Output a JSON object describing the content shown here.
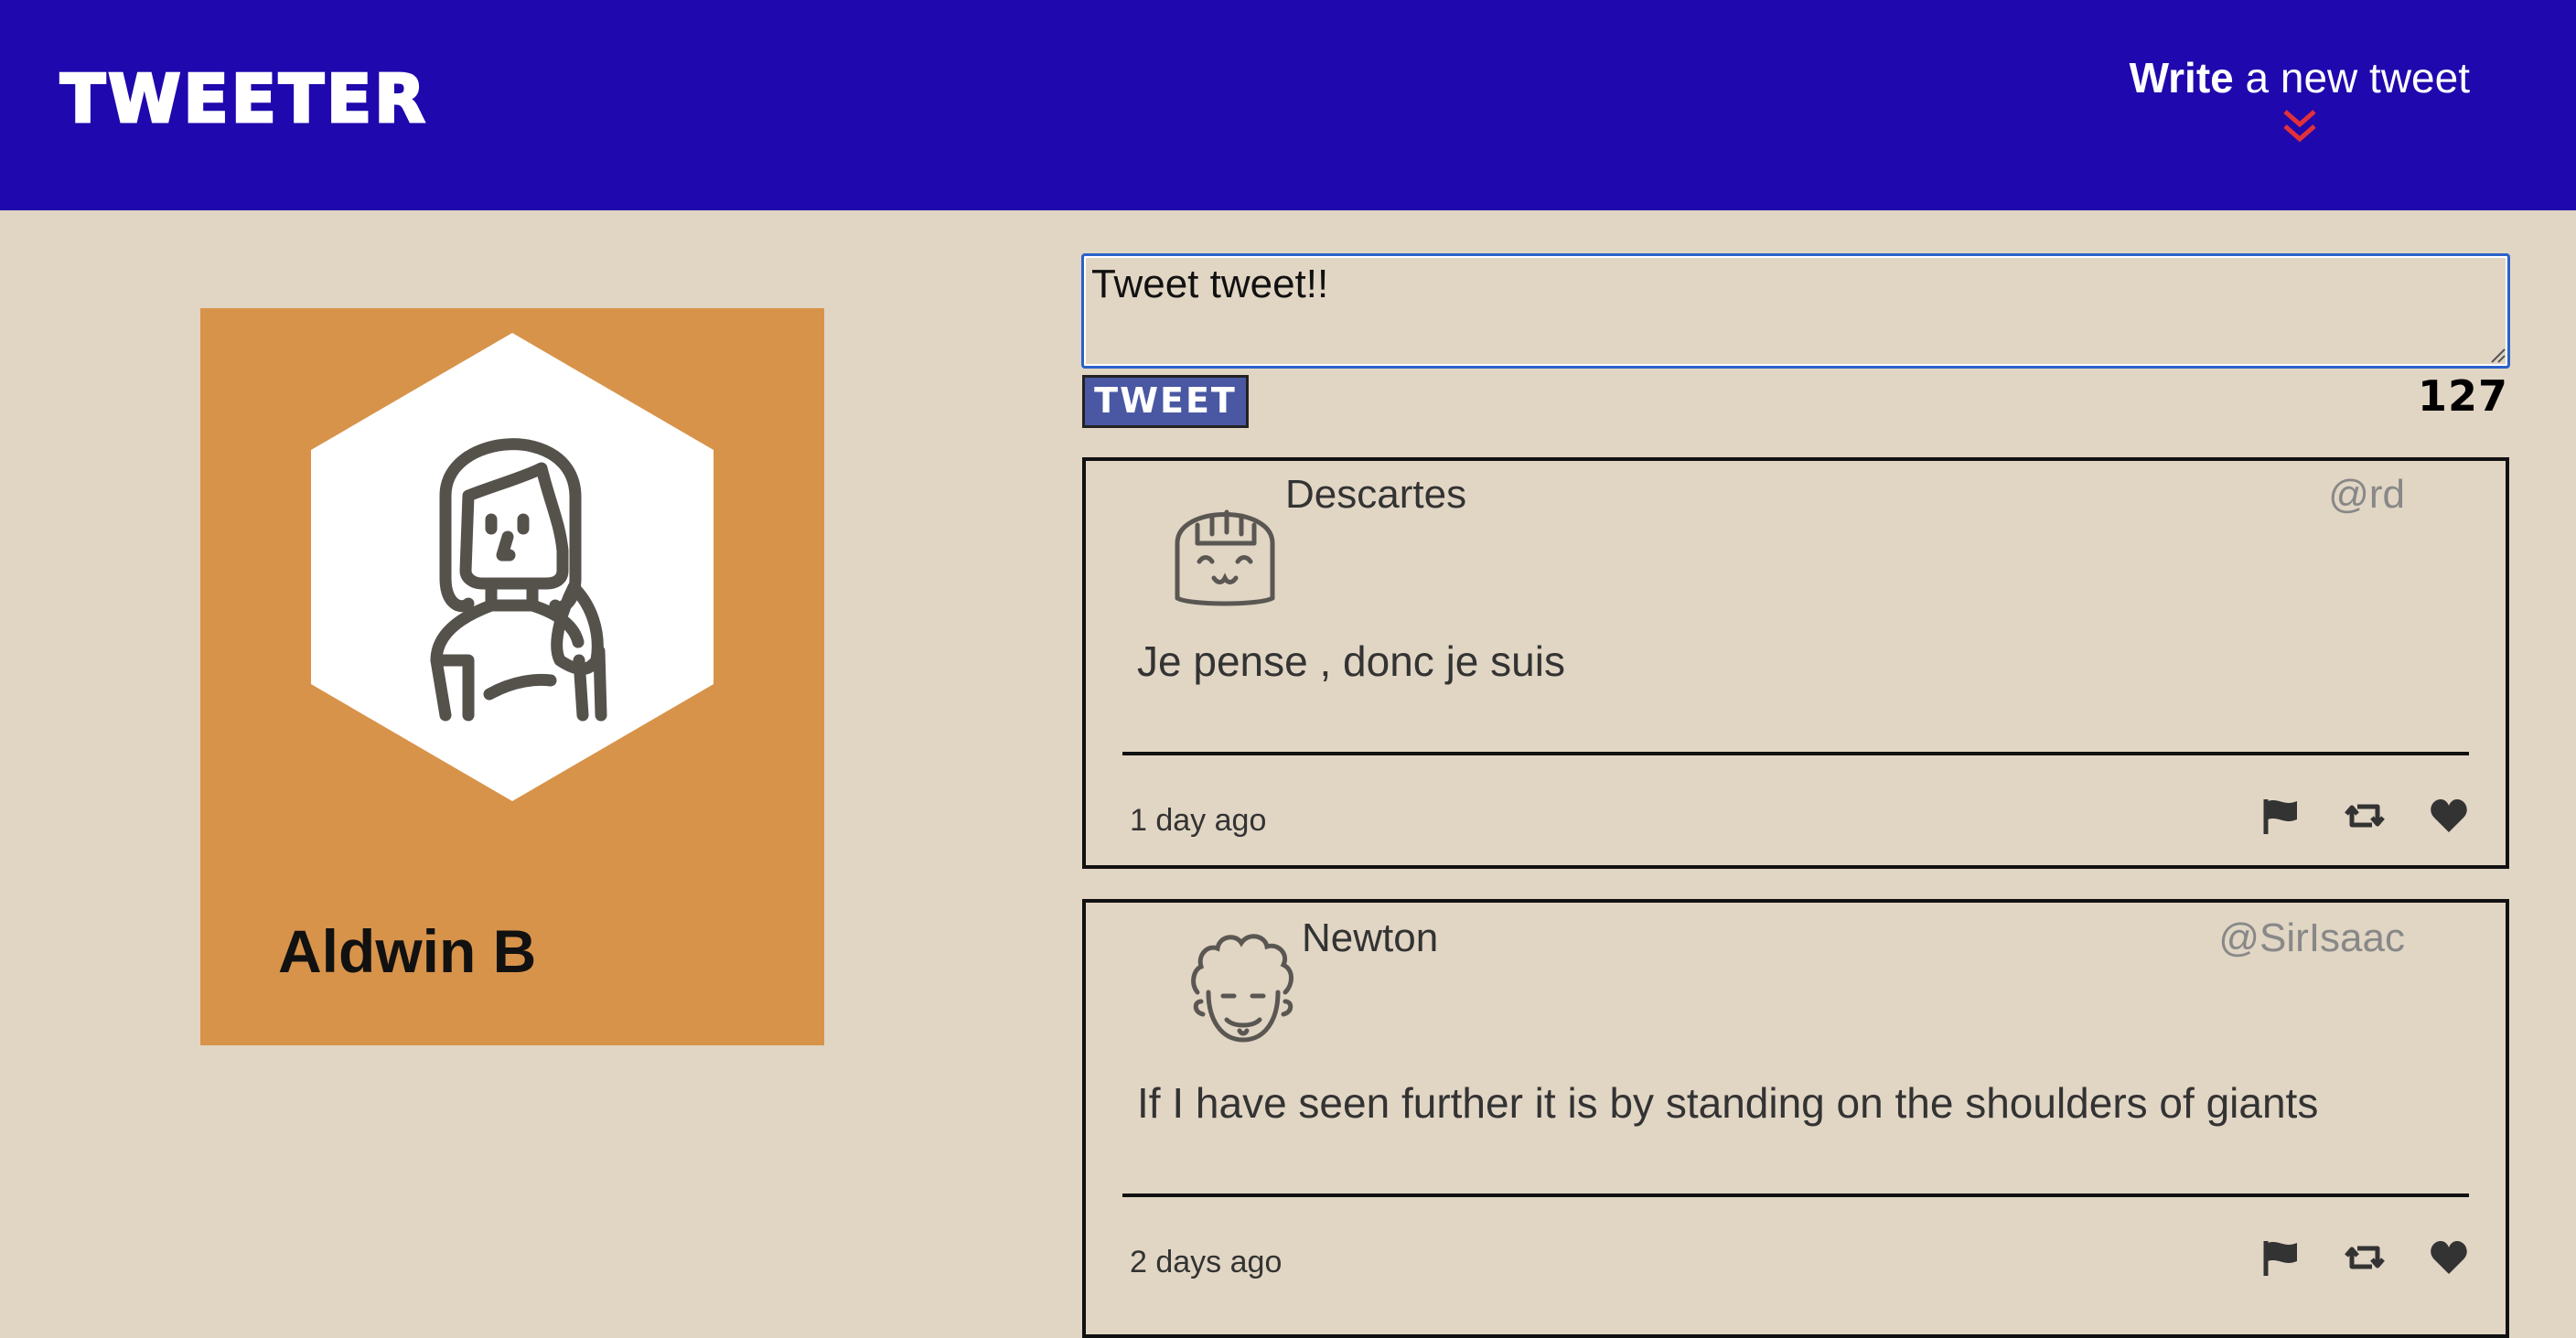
{
  "nav": {
    "brand": "TWEETER",
    "write_bold": "Write",
    "write_rest": " a new tweet"
  },
  "profile": {
    "name": "Aldwin B"
  },
  "composer": {
    "value": "Tweet tweet!!",
    "button_label": "TWEET",
    "counter": "127"
  },
  "tweets": [
    {
      "author": "Descartes",
      "handle": "@rd",
      "content": "Je pense , donc je suis",
      "time": "1 day ago",
      "actions": [
        "flag-icon",
        "retweet-icon",
        "heart-icon"
      ]
    },
    {
      "author": "Newton",
      "handle": "@SirIsaac",
      "content": "If I have seen further it is by standing on the shoulders of giants",
      "time": "2 days ago",
      "actions": [
        "flag-icon",
        "retweet-icon",
        "heart-icon"
      ]
    }
  ],
  "colors": {
    "nav_bg": "#1f08ad",
    "page_bg": "#e1d5c4",
    "profile_bg": "#d8934a",
    "tweet_button": "#4a58a3",
    "chevron": "#e0313a"
  }
}
